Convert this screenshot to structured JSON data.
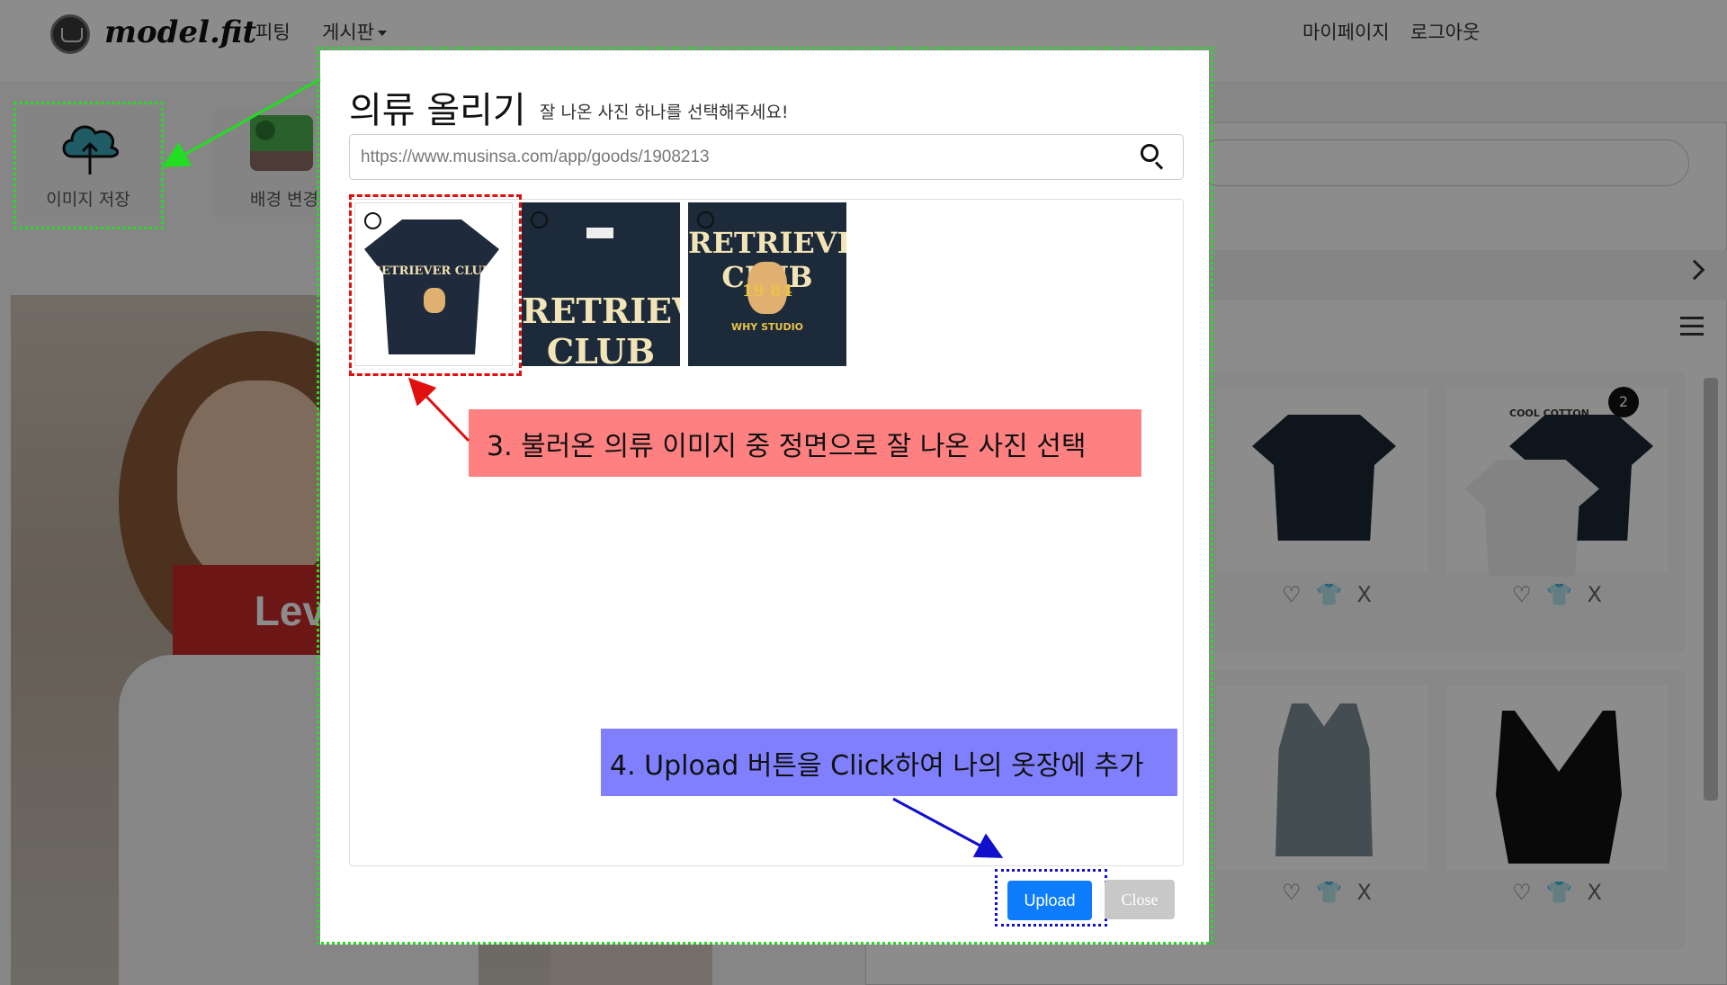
{
  "navbar": {
    "logo_text": "model.fit",
    "fitting_label": "피팅",
    "board_label": "게시판",
    "mypage_label": "마이페이지",
    "logout_label": "로그아웃"
  },
  "toolbar": {
    "save_label": "이미지 저장",
    "background_label": "배경 변경"
  },
  "background_photo": {
    "logo_text": "Levi's"
  },
  "closet": {
    "cool_cotton": "COOL COTTON",
    "badge": "2",
    "actions": [
      "♡",
      "👕",
      "X"
    ]
  },
  "modal": {
    "title": "의류 올리기",
    "subtitle": "잘 나온 사진 하나를 선택해주세요!",
    "url_value": "https://www.musinsa.com/app/goods/1908213",
    "thumbnail_1_print": "RETRIEVER CLUB",
    "thumbnail_2_print": "RETRIEVER CLUB",
    "thumbnail_3_print": "RETRIEVER CLUB",
    "thumbnail_3_year": "19 84",
    "thumbnail_3_studio": "WHY STUDIO",
    "upload_label": "Upload",
    "close_label": "Close"
  },
  "annotations": {
    "step3": "3. 불러온 의류 이미지 중 정면으로 잘 나온 사진 선택",
    "step4": "4. Upload 버튼을 Click하여 나의 옷장에 추가"
  }
}
